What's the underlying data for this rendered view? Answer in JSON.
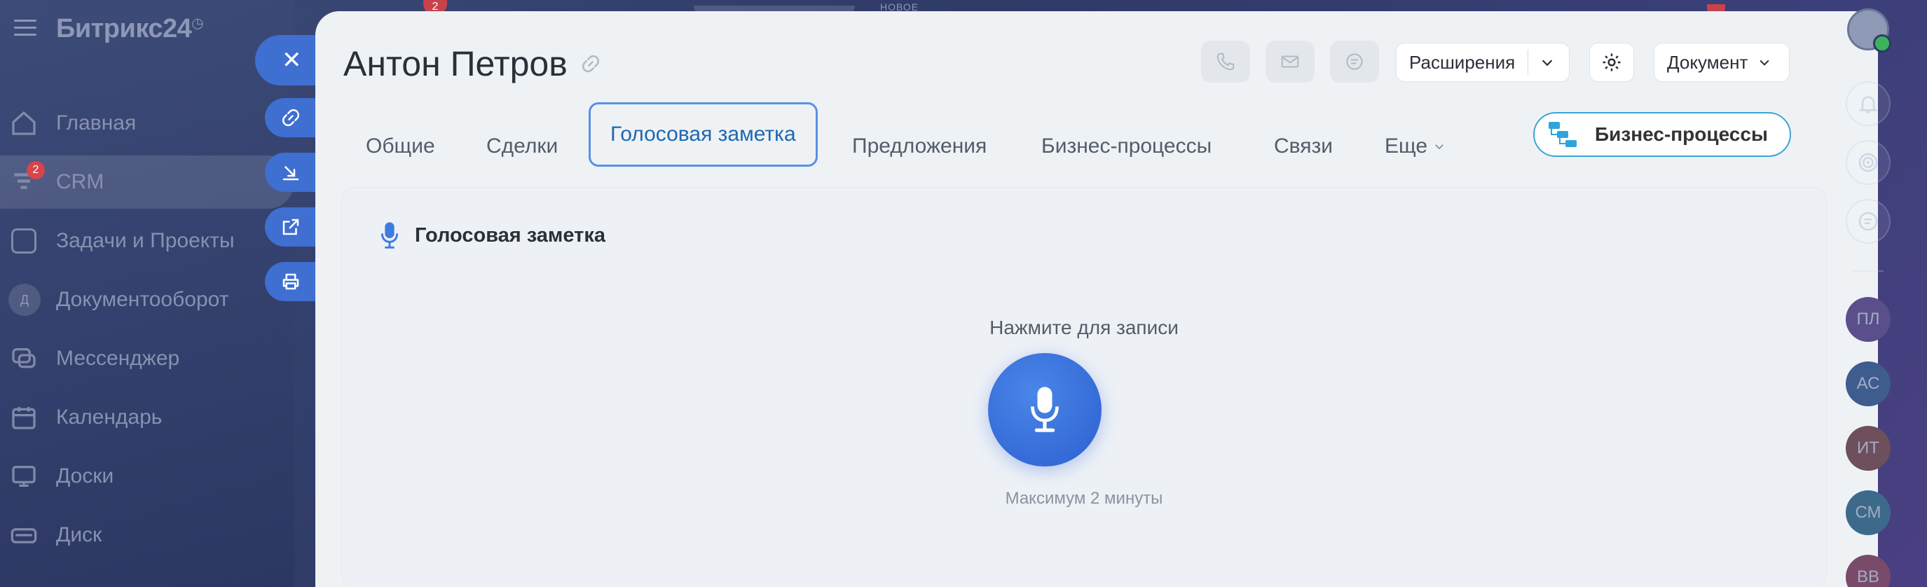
{
  "app": {
    "brand": "Битрикс24",
    "brand_clock": "◷"
  },
  "sidebar": {
    "items": [
      {
        "label": "Главная"
      },
      {
        "label": "CRM",
        "badge": "2"
      },
      {
        "label": "Задачи и Проекты"
      },
      {
        "label": "Документооборот",
        "icon_letter": "Д"
      },
      {
        "label": "Мессенджер"
      },
      {
        "label": "Календарь"
      },
      {
        "label": "Доски"
      },
      {
        "label": "Диск"
      }
    ]
  },
  "topbar": {
    "badge": "2",
    "new_label": "НОВОЕ"
  },
  "slider": {
    "close_label": "✕"
  },
  "entity": {
    "title": "Антон Петров"
  },
  "header": {
    "extensions_label": "Расширения",
    "document_label": "Документ"
  },
  "tabs": [
    {
      "label": "Общие"
    },
    {
      "label": "Сделки"
    },
    {
      "label": "Голосовая заметка",
      "active": true
    },
    {
      "label": "Предложения"
    },
    {
      "label": "Бизнес-процессы"
    },
    {
      "label": "Связи"
    },
    {
      "label": "Еще"
    }
  ],
  "bp_button": {
    "label": "Бизнес-процессы"
  },
  "voice_note": {
    "heading": "Голосовая заметка",
    "hint": "Нажмите для записи",
    "max": "Максимум 2 минуты"
  },
  "rail": {
    "users": [
      {
        "initials": "ПЛ",
        "color": "#5a4f8a"
      },
      {
        "initials": "АС",
        "color": "#3f5c8e"
      },
      {
        "initials": "ИТ",
        "color": "#6e4f5c"
      },
      {
        "initials": "СМ",
        "color": "#3d6a8a"
      },
      {
        "initials": "ВВ",
        "color": "#7a4a6a"
      }
    ]
  },
  "colors": {
    "accent": "#3f6fd0",
    "tab_active": "#2067b0",
    "bp_border": "#3aa6d8",
    "badge": "#d9434b"
  }
}
